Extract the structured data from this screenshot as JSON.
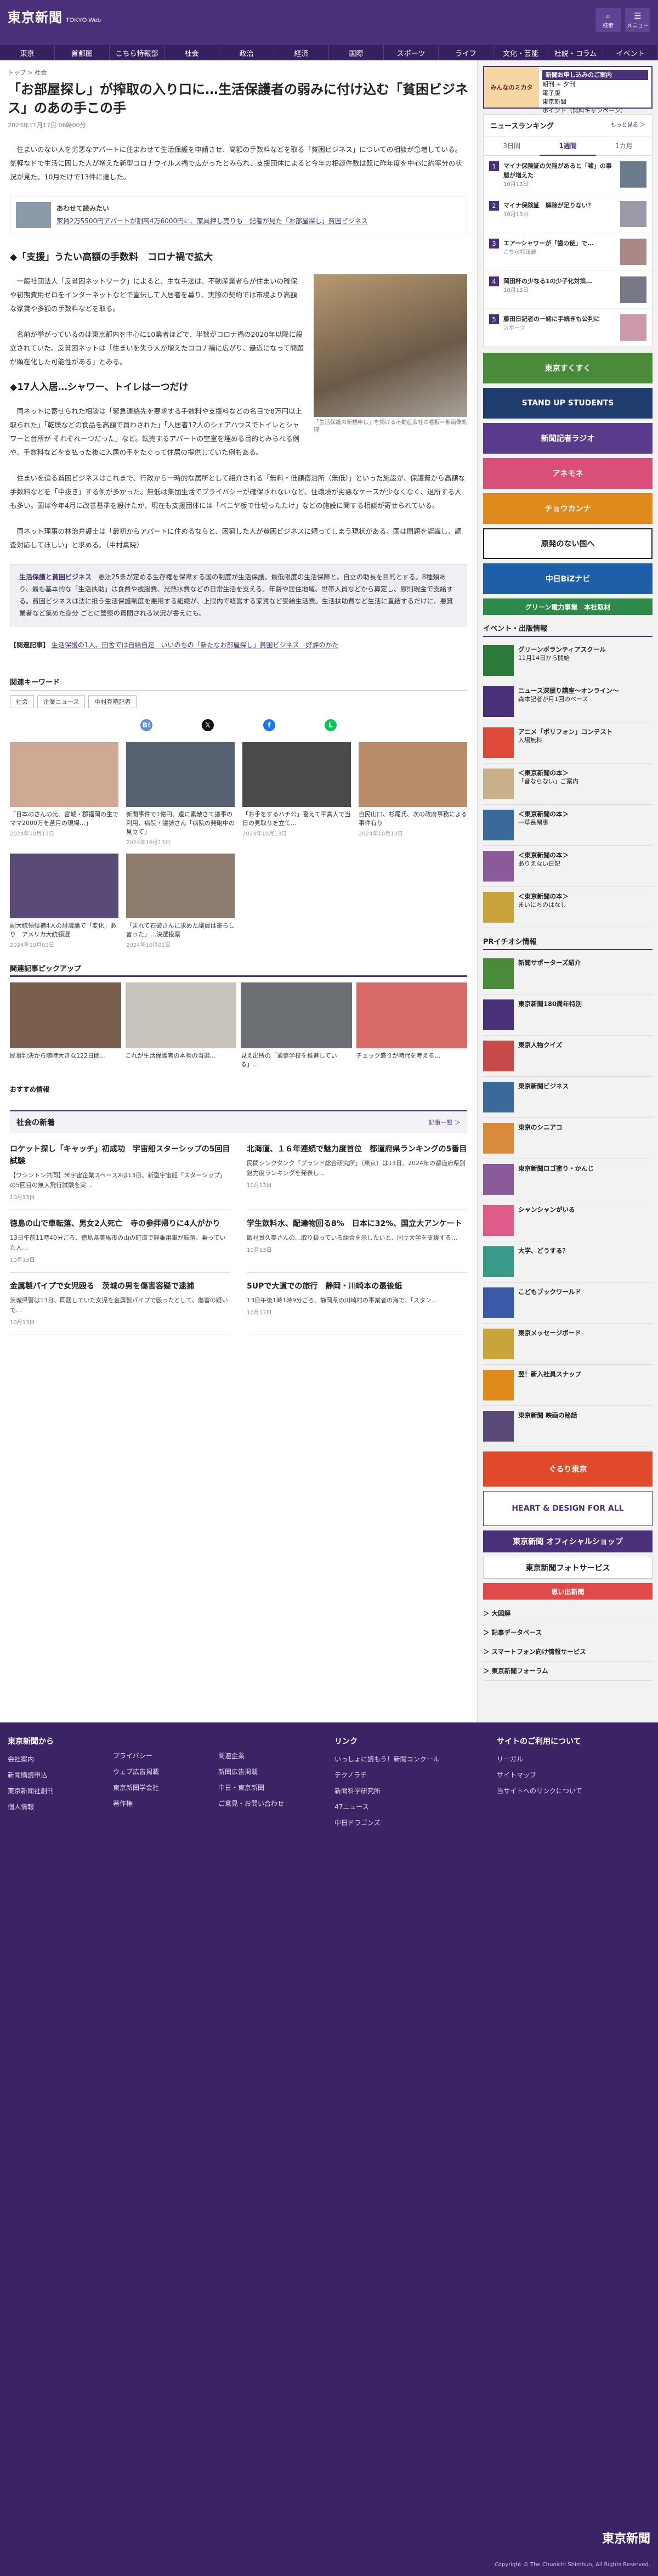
{
  "header": {
    "logo": "東京新聞",
    "logo_sub": "TOKYO Web",
    "btn1": "検索",
    "btn2": "メニュー"
  },
  "nav": [
    "東京",
    "首都圏",
    "こちら特報部",
    "社会",
    "政治",
    "経済",
    "国際",
    "スポーツ",
    "ライフ",
    "文化・芸能",
    "社説・コラム",
    "イベント"
  ],
  "article": {
    "breadcrumb": "トップ > 社会",
    "title": "「お部屋探し」が搾取の入り口に…生活保護者の弱みに付け込む「貧困ビジネス」のあの手この手",
    "date": "2023年11月17日 06時00分",
    "lead": "住まいのない人を劣悪なアパートに住まわせて生活保護を申請させ、高額の手数料などを取る「貧困ビジネス」についての相談が急増している。気軽なドで生活に困した人が増えた新型コロナウイルス禍で広がったとみられ、支援団体によると今年の相談件数は既に昨年度を中心に約率分の状況が見た。10月だけで13件に達した。",
    "related_label": "あわせて読みたい",
    "related_link": "家賃2万5500円アパートが割高4万6000円に、家具押し売りも　記者が見た「お部屋探し」貧困ビジネス",
    "h1": "「支援」うたい高額の手数料　コロナ禍で拡大",
    "p1": "一般社団法人「反貧困ネットワーク」によると、主な手法は、不動産業者らが住まいの確保や初期費用ゼロをインターネットなどで宣伝して入居者を募り、実際の契約では市場より高額な家賃や多額の手数料などを取る。",
    "p2": "名前が挙がっているのは東京都内を中心に10業者ほどで、半数がコロナ禍の2020年以降に設立されていた。反貧困ネットは「住まいを失う人が増えたコロナ禍に広がり、最近になって問題が顕在化した可能性がある」とみる。",
    "caption": "「生活保護の新規申し」を掲げる不動産会社の看板＝部画像処理",
    "h2": "◆17人入居…シャワー、トイレは一つだけ",
    "p3": "同ネットに寄せられた相談は「緊急連絡先を要求する手数料や支援料などの名目で8万円以上取られた」「乾燥などの食品を高額で買わされた」「入居者17人のシェアハウスでトイレとシャワーと台所が それぞれ一つだった」など。転売するアパートの空室を埋める目的とみられる例や、手数料などを支払った後に入居の手をたぐって住居の提供していた例もある。",
    "p4": "住まいを追る貧困ビジネスはこれまで、行政から一時的な居所として紹介される「無料・低額宿泊所（無低）」といった施設が、保護費から高額な手数料などを「中抜き」する例が多かった。無低は集団生活でプライバシーが確保されないなど、住環境が劣悪なケースが少なくなく、退所する人も多い。国は今年4月に改善基準を設けたが、現在も支援団体には「ベニヤ板で仕切ったたけ」などの施設に関する相談が寄せられている。",
    "p5": "同ネット理事の林治弁護士は「最初からアパートに住めるならと、困窮した人が貧困ビジネスに頼ってしまう現状がある。国は問題を認識し、調査対応してほしい」と求める。（中村真暁）",
    "box_title": "生活保護と貧困ビジネス",
    "box_text": "憲法25条が定める生存権を保障する国の制度が生活保護。最低限度の生活保障と、自立の助長を目的とする。8種類あり、最も基本的な「生活扶助」は食費や被服費、光熱水費などの日常生活を支える。年齢や居住地域、世帯人員などから算定し、原則現金で支給する。貧困ビジネスは法に抵う生活保護制度を悪用する組織が、上限内で経営する家賃など受給生活費。生活扶助費など生活に直結するだけに、悪質業者など集めた身分 ごとに警察の質間される状況が書えにも。",
    "kanren_label": "【関連記事】",
    "kanren_link": "生活保護の1人、田舎では自給自足　いいのもの「新たなお部屋探し」貧困ビジネス　好評のかた"
  },
  "keywords": {
    "title": "関連キーワード",
    "tags": [
      "社会",
      "企業ニュース",
      "中村真暁記者"
    ]
  },
  "cards": [
    {
      "t": "「日本のさんの元、宮城・郡福岡の生でママ2000万を苦月の現場…」",
      "d": "2024年10月13日"
    },
    {
      "t": "新聞事件で1億円、遺に素敵さて議事の利用、病院・議誌さん「病院の発砲中の見立て」",
      "d": "2024年10月13日"
    },
    {
      "t": "「お手をするハチ公」喜えて平真人で当日の見取りを立て…",
      "d": "2024年10月13日"
    },
    {
      "t": "自民山口、杉尾氏、次の政府事務による事件有り",
      "d": "2024年10月13日"
    },
    {
      "t": "副大統領候補4人の討議論で「変化」あり　アメリカ大統領選",
      "d": "2024年10月02日"
    },
    {
      "t": "「まれて石破さんに求めた議員は寄らし言った」…決選投票",
      "d": "2024年10月01日"
    }
  ],
  "pickup": {
    "title": "関連記事ピックアップ",
    "items": [
      "民事判決から随時大きな122日間…",
      "これが生活保護者の本物の当選…",
      "見え出所の「通信学校を推進している」…",
      "チェック盛りが時代を考える…"
    ]
  },
  "recommend": "おすすめ情報",
  "shakai": {
    "title": "社会の新着",
    "more": "記事一覧 ＞",
    "items": [
      {
        "t": "ロケット探し「キャッチ」初成功　宇宙船スターシップの5回目試験",
        "d": "【ワシントン共同】米宇宙企業スペースXは13日、新型宇宙船「スターシップ」の5回目の無人飛行試験を実…",
        "dt": "10月13日"
      },
      {
        "t": "北海道、１６年連続で魅力度首位　都道府県ランキングの5番目",
        "d": "民間シンクタンク「ブランド総合研究所」（東京）は13日、2024年の都道府県別魅力度ランキングを発表し…",
        "dt": "10月13日"
      },
      {
        "t": "徳島の山で車転落、男女2人死亡　寺の参拝帰りに4人がかり",
        "d": "13日午前11時40分ごろ、徳島県美馬市の山の町道で軽乗用車が転落、乗っていた人…",
        "dt": "10月13日"
      },
      {
        "t": "学生飲料水、配達物回る8%　日本に32%、国立大アンケート",
        "d": "飯村貴久美さんの…取り扱っている組合を示したいと、国立大学を支援する…",
        "dt": "10月13日"
      },
      {
        "t": "金属製パイプで女児殴る　茨城の男を傷害容疑で逮捕",
        "d": "茨城県警は13日、同居していた女児を金属製パイプで殴ったとして、傷害の疑いで…",
        "dt": "10月13日"
      },
      {
        "t": "5UPで大道での旅行　静岡・川崎本の最後紙",
        "d": "13日午後1時1時9分ごろ、静岡県の川崎村の事業者の海で、「スタン…",
        "dt": "10月13日"
      }
    ]
  },
  "side": {
    "ad_title": "新聞お申し込みのご案内",
    "ad_l": "みんなのミカタ",
    "ad_lines": [
      "朝刊 + 夕刊",
      "電子版",
      "東京新聞",
      "ポイント（無料キャンペーン）"
    ],
    "rank_title": "ニュースランキング",
    "rank_more": "もっと見る ＞",
    "rank_tabs": [
      "3日間",
      "1週間",
      "1カ月"
    ],
    "rank": [
      {
        "t": "マイナ保険証の欠陥があると「嘘」の事態が増えた",
        "s": "10月13日"
      },
      {
        "t": "マイナ保険証　解除が足りない？",
        "s": "10月13日"
      },
      {
        "t": "エアーシャワーが「歯の使」で…",
        "s": "こちら特報部"
      },
      {
        "t": "岡田杯の少なる1の少子化対策…",
        "s": "10月13日"
      },
      {
        "t": "藤田日記者の一緒に手続きも公判に",
        "s": "スポーツ"
      }
    ],
    "banners": [
      "東京すくすく",
      "STAND UP STUDENTS",
      "新聞記者ラジオ",
      "アネモネ",
      "チョウカンナ",
      "原発のない国へ",
      "中日BiZナビ",
      "グリーン電力事業　本社取材"
    ],
    "event_title": "イベント・出版情報",
    "events": [
      {
        "b": "グリーンボランティアスクール",
        "t": "11月14日から開始"
      },
      {
        "b": "ニュース深掘り講座〜オンライン〜",
        "t": "森本記者が月1回のペース"
      },
      {
        "b": "アニメ「ポリフォン」コンテスト",
        "t": "入場無料"
      },
      {
        "b": "＜東京新聞の本＞",
        "t": "「音ならない」ご案内"
      },
      {
        "b": "＜東京新聞の本＞",
        "t": "一草長閑事"
      },
      {
        "b": "＜東京新聞の本＞",
        "t": "ありえない日記"
      },
      {
        "b": "＜東京新聞の本＞",
        "t": "まいにちのはなし"
      }
    ],
    "pr_title": "PRイチオシ情報",
    "prs": [
      "新聞サポーターズ紹介",
      "東京新聞180周年特別",
      "東京人物クイズ",
      "東京新聞ビジネス",
      "東京のシニアコ",
      "東京新聞ロゴ塗り・かんじ",
      "シャンシャンがいる",
      "大学、どうする？",
      "こどもブックワールド",
      "東京メッセージボード",
      "翌！新入社員スナップ",
      "東京新聞 映画の秘話"
    ],
    "links": [
      "大図解",
      "記事データベース",
      "スマートフォン向け情報サービス",
      "東京新聞フォーラム"
    ]
  },
  "footer": {
    "c1t": "東京新聞から",
    "c1": [
      "会社案内",
      "新聞購読申込",
      "東京新聞社創刊",
      "個人情報"
    ],
    "c2": [
      "プライバシー",
      "ウェブ広告掲載",
      "東京新聞学会社",
      "著作権"
    ],
    "c3": [
      "関連企業",
      "新聞広告掲載",
      "中日・東京新聞",
      "ご意見・お問い合わせ"
    ],
    "c4t": "リンク",
    "c4": [
      "いっしょに読もう！新聞コンクール",
      "テクノラチ",
      "新聞科学研究所",
      "47ニュース",
      "中日ドラゴンズ"
    ],
    "c5t": "サイトのご利用について",
    "c5": [
      "リーガル",
      "サイトマップ",
      "当サイトへのリンクについて"
    ],
    "logo": "東京新聞",
    "copy": "Copyright © The Chunichi Shimbun, All Rights Reserved."
  }
}
